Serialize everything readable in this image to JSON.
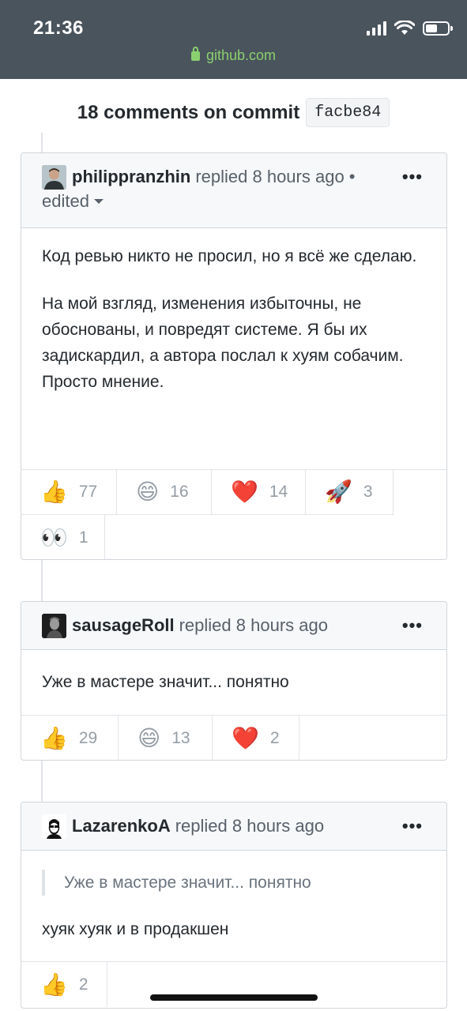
{
  "status_bar": {
    "time": "21:36",
    "url": "github.com"
  },
  "header": {
    "title": "18 comments on commit",
    "sha": "facbe84"
  },
  "comments": [
    {
      "author": "philippranzhin",
      "meta": "replied 8 hours ago •",
      "edited": "edited",
      "more": "•••",
      "paragraphs": [
        "Код ревью никто не просил, но я всё же сделаю.",
        "На мой взгляд, изменения избыточны, не обоснованы, и повредят системе. Я бы их задискардил, а автора послал к хуям собачим.",
        "Просто мнение."
      ],
      "reactions": [
        {
          "emoji": "👍",
          "count": "77"
        },
        {
          "emoji": "😄",
          "count": "16"
        },
        {
          "emoji": "❤️",
          "count": "14"
        },
        {
          "emoji": "🚀",
          "count": "3"
        },
        {
          "emoji": "👀",
          "count": "1"
        }
      ]
    },
    {
      "author": "sausageRoll",
      "meta": "replied 8 hours ago",
      "more": "•••",
      "text": "Уже в мастере значит... понятно",
      "reactions": [
        {
          "emoji": "👍",
          "count": "29"
        },
        {
          "emoji": "😄",
          "count": "13"
        },
        {
          "emoji": "❤️",
          "count": "2"
        }
      ]
    },
    {
      "author": "LazarenkoA",
      "meta": "replied 8 hours ago",
      "more": "•••",
      "quote": "Уже в мастере значит... понятно",
      "text": "хуяк хуяк и в продакшен",
      "reactions": [
        {
          "emoji": "👍",
          "count": "2"
        }
      ]
    }
  ]
}
